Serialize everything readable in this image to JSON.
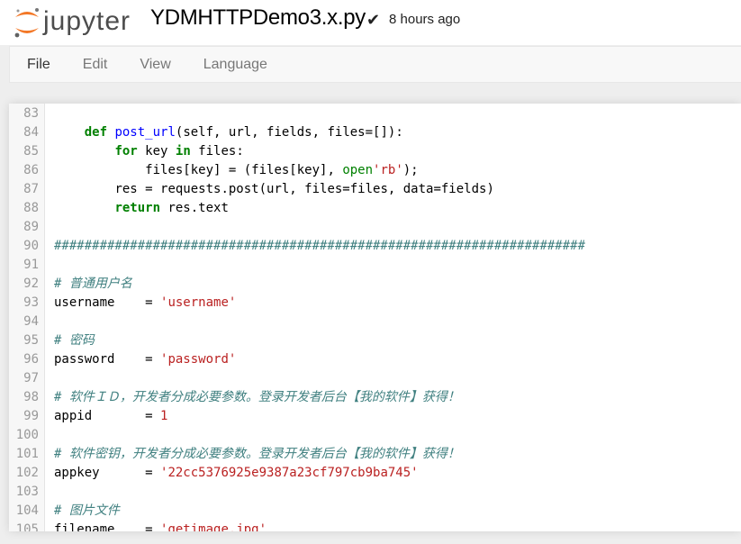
{
  "header": {
    "logo_text": "jupyter",
    "notebook_name": "YDMHTTPDemo3.x.py",
    "saved_check": "✔",
    "save_status": "8 hours ago"
  },
  "menu": {
    "items": [
      "File",
      "Edit",
      "View",
      "Language"
    ]
  },
  "colors": {
    "keyword": "#008000",
    "def_name": "#0000ff",
    "string": "#ba2121",
    "comment": "#408080",
    "logo_orange": "#f37726"
  },
  "code": {
    "lines": [
      {
        "n": "83"
      },
      {
        "n": "84",
        "indent": "    ",
        "kw1": "def",
        "sp": " ",
        "fn": "post_url",
        "rest": "(self, url, fields, files=[]):"
      },
      {
        "n": "85",
        "indent": "        ",
        "kw1": "for",
        "a": " key ",
        "kw2": "in",
        "b": " files:"
      },
      {
        "n": "86",
        "indent": "            ",
        "a": "files[key] = ",
        "bi": "open",
        "b": "(files[key], ",
        "s": "'rb'",
        "c": ");"
      },
      {
        "n": "87",
        "indent": "        ",
        "a": "res = requests.post(url, files=files, data=fields)"
      },
      {
        "n": "88",
        "indent": "        ",
        "kw1": "return",
        "a": " res.text"
      },
      {
        "n": "89"
      },
      {
        "n": "90",
        "cm": "######################################################################"
      },
      {
        "n": "91"
      },
      {
        "n": "92",
        "cm": "# 普通用户名"
      },
      {
        "n": "93",
        "a": "username    = ",
        "s": "'username'"
      },
      {
        "n": "94"
      },
      {
        "n": "95",
        "cm": "# 密码"
      },
      {
        "n": "96",
        "a": "password    = ",
        "s": "'password'"
      },
      {
        "n": "97"
      },
      {
        "n": "98",
        "cm": "# 软件ＩＤ，开发者分成必要参数。登录开发者后台【我的软件】获得！"
      },
      {
        "n": "99",
        "a": "appid       = ",
        "s": "1"
      },
      {
        "n": "100"
      },
      {
        "n": "101",
        "cm": "# 软件密钥，开发者分成必要参数。登录开发者后台【我的软件】获得！"
      },
      {
        "n": "102",
        "a": "appkey      = ",
        "s": "'22cc5376925e9387a23cf797cb9ba745'"
      },
      {
        "n": "103"
      },
      {
        "n": "104",
        "cm": "# 图片文件"
      },
      {
        "n": "105",
        "a": "filename    = ",
        "s": "'getimage.jpg'"
      }
    ]
  }
}
